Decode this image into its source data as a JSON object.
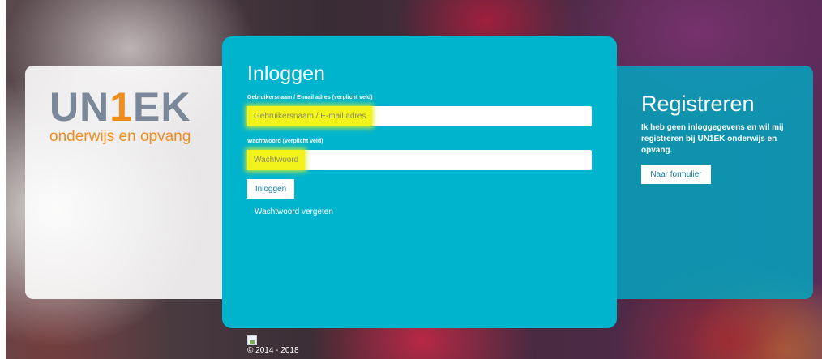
{
  "logo": {
    "main_pre": "UN",
    "main_one": "1",
    "main_post": "EK",
    "sub": "onderwijs en opvang"
  },
  "login": {
    "title": "Inloggen",
    "username_label": "Gebruikersnaam / E-mail adres  (verplicht veld)",
    "username_placeholder": "Gebruikersnaam / E-mail adres",
    "password_label": "Wachtwoord  (verplicht veld)",
    "password_placeholder": "Wachtwoord",
    "submit_label": "Inloggen",
    "forgot_label": "Wachtwoord vergeten"
  },
  "register": {
    "title": "Registreren",
    "text": "Ik heb geen inloggegevens en wil mij registreren bij UN1EK onderwijs en opvang.",
    "button_label": "Naar formulier"
  },
  "footer": {
    "copyright": "© 2014 - 2018",
    "image_icon": "broken-image-icon"
  },
  "colors": {
    "accent": "#00b4cd",
    "logo_gray": "#7b8899",
    "logo_orange": "#f08c1e",
    "highlight": "#f2f31b"
  }
}
